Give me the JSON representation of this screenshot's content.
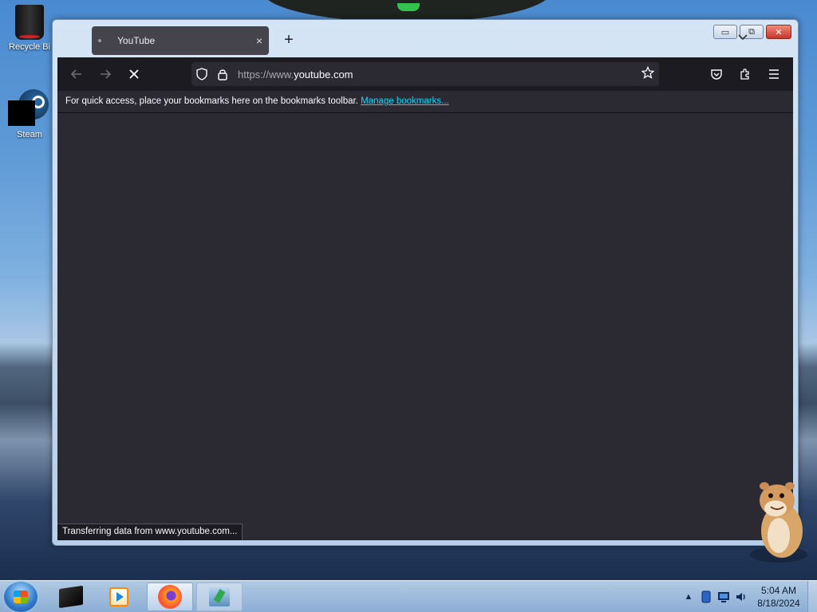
{
  "desktop": {
    "icons": [
      {
        "label": "Recycle Bi",
        "icon": "recycle-bin-icon"
      },
      {
        "label": "Steam",
        "icon": "steam-icon"
      }
    ]
  },
  "browser": {
    "tab": {
      "title": "YouTube",
      "close": "×"
    },
    "new_tab": "+",
    "list_tabs": "⌄",
    "window_controls": {
      "minimize": "▭",
      "maximize": "⧉",
      "close": "✕"
    },
    "nav": {
      "back": "←",
      "forward": "→",
      "stop": "✕"
    },
    "url": {
      "prefix": "https://www.",
      "domain": "youtube.com"
    },
    "bookmarks_bar": {
      "message": "For quick access, place your bookmarks here on the bookmarks toolbar.",
      "link": "Manage bookmarks..."
    },
    "status": "Transferring data from www.youtube.com...",
    "colors": {
      "page_bg": "#2b2a33",
      "toolbar_bg": "#1c1b22",
      "link": "#00ddff"
    }
  },
  "taskbar": {
    "apps": [
      {
        "name": "terminal-app",
        "icon": "terminal-icon"
      },
      {
        "name": "media-player-app",
        "icon": "media-player-icon"
      },
      {
        "name": "firefox-app",
        "icon": "firefox-icon",
        "active": true
      },
      {
        "name": "tool-app",
        "icon": "tool-icon"
      }
    ],
    "tray": {
      "overflow": "▲"
    },
    "clock": {
      "time": "5:04 AM",
      "date": "8/18/2024"
    }
  }
}
